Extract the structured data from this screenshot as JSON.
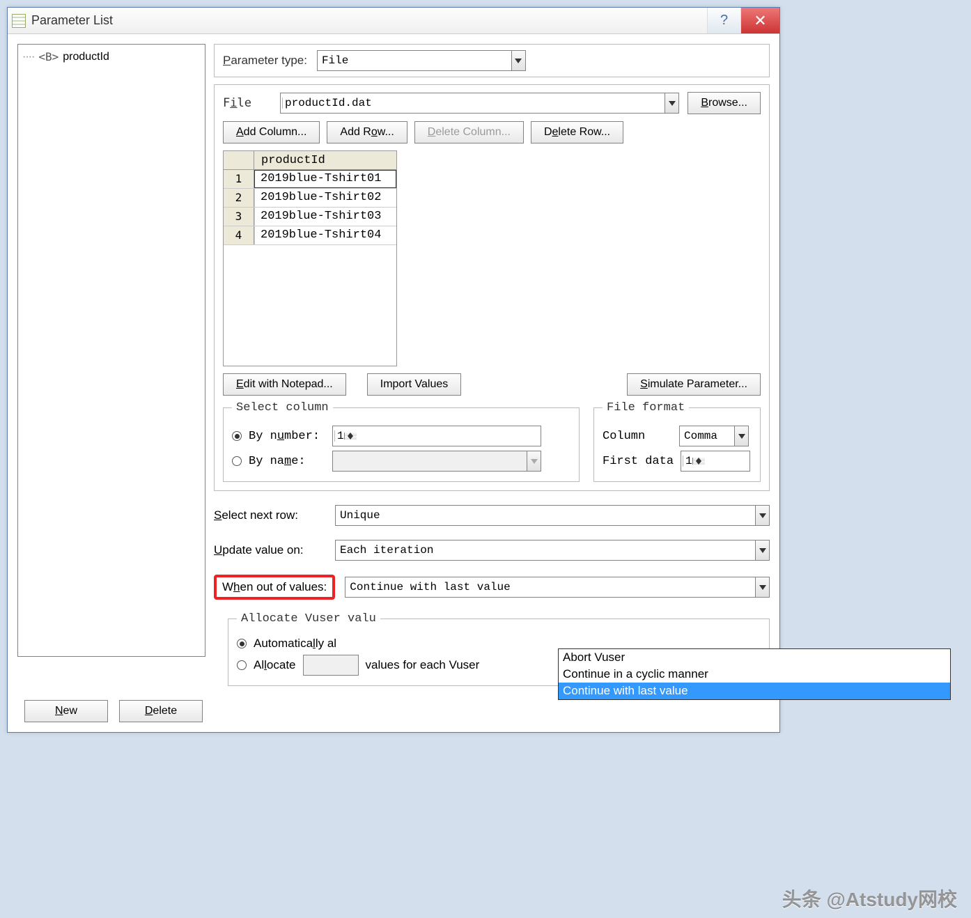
{
  "window": {
    "title": "Parameter List"
  },
  "titlebar": {
    "help": "?",
    "close": "✕"
  },
  "tree": {
    "item": "productId",
    "icon": "<B>"
  },
  "param_type": {
    "label_html": "<span class='accel'>P</span>arameter type:",
    "value": "File"
  },
  "file": {
    "label_html": "F<span class='accel'>i</span>le",
    "value": "productId.dat",
    "browse_html": "<span class='accel'>B</span>rowse..."
  },
  "grid_buttons": {
    "add_col_html": "<span class='accel'>A</span>dd Column...",
    "add_row_html": "Add R<span class='accel'>o</span>w...",
    "del_col_html": "<span class='accel'>D</span>elete Column...",
    "del_row_html": "D<span class='accel'>e</span>lete Row..."
  },
  "grid": {
    "header": "productId",
    "rows": [
      {
        "n": "1",
        "v": "2019blue-Tshirt01"
      },
      {
        "n": "2",
        "v": "2019blue-Tshirt02"
      },
      {
        "n": "3",
        "v": "2019blue-Tshirt03"
      },
      {
        "n": "4",
        "v": "2019blue-Tshirt04"
      }
    ]
  },
  "edit_row": {
    "notepad_html": "<span class='accel'>E</span>dit with Notepad...",
    "import": "Import Values",
    "simulate_html": "<span class='accel'>S</span>imulate Parameter..."
  },
  "select_column": {
    "legend": "Select column",
    "by_number_html": "By n<span class='accel'>u</span>mber:",
    "by_name_html": "By na<span class='accel'>m</span>e:",
    "number_value": "1"
  },
  "file_format": {
    "legend": "File format",
    "column": "Column",
    "column_val": "Comma",
    "first_data": "First data",
    "first_data_val": "1"
  },
  "sel_next": {
    "label_html": "<span class='accel'>S</span>elect next row:",
    "value": "Unique"
  },
  "update_on": {
    "label_html": "<span class='accel'>U</span>pdate value on:",
    "value": "Each iteration"
  },
  "out_of_values": {
    "label_html": "W<span class='accel'>h</span>en out of values:",
    "value": "Continue with last value",
    "options": [
      "Abort Vuser",
      "Continue in a cyclic manner",
      "Continue with last value"
    ],
    "selected_index": 2
  },
  "allocate": {
    "legend": "Allocate Vuser valu",
    "auto_html": "Automatica<span class='accel'>l</span>ly al",
    "alloc_html": "Al<span class='accel'>l</span>ocate",
    "suffix": "values for each Vuser"
  },
  "bottom": {
    "new_html": "<span class='accel'>N</span>ew",
    "delete_html": "<span class='accel'>D</span>elete"
  },
  "watermark": "头条 @Atstudy网校"
}
